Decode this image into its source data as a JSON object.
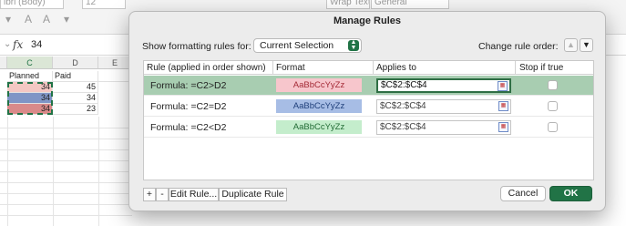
{
  "ribbon": {
    "font_name": "ibri (Body)",
    "font_size": "12",
    "wrap_text": "Wrap Text",
    "number_format": "General"
  },
  "formula_bar": {
    "fx_label": "fx",
    "value": "34"
  },
  "sheet": {
    "columns": [
      "C",
      "D",
      "E"
    ],
    "headers": {
      "c": "Planned",
      "d": "Paid"
    },
    "rows": [
      {
        "c": "34",
        "d": "45",
        "c_fill": "#f4c7c3"
      },
      {
        "c": "34",
        "d": "34",
        "c_fill": "#a4b7dc"
      },
      {
        "c": "34",
        "d": "23",
        "c_fill": "#c6e7c3"
      }
    ]
  },
  "dialog": {
    "title": "Manage Rules",
    "show_label": "Show formatting rules for:",
    "scope": "Current Selection",
    "order_label": "Change rule order:",
    "columns": {
      "rule": "Rule (applied in order shown)",
      "format": "Format",
      "applies": "Applies to",
      "stop": "Stop if true"
    },
    "rules": [
      {
        "rule": "Formula: =C2>D2",
        "preview": "AaBbCcYyZz",
        "bg": "#f7c6cc",
        "fg": "#a42a36",
        "applies": "$C$2:$C$4",
        "stop": false,
        "selected": true
      },
      {
        "rule": "Formula: =C2=D2",
        "preview": "AaBbCcYyZz",
        "bg": "#a7bde5",
        "fg": "#1f3f7a",
        "applies": "$C$2:$C$4",
        "stop": false,
        "selected": false
      },
      {
        "rule": "Formula: =C2<D2",
        "preview": "AaBbCcYyZz",
        "bg": "#c4edcc",
        "fg": "#226b35",
        "applies": "$C$2:$C$4",
        "stop": false,
        "selected": false
      }
    ],
    "buttons": {
      "add": "+",
      "remove": "-",
      "edit": "Edit Rule...",
      "duplicate": "Duplicate Rule",
      "cancel": "Cancel",
      "ok": "OK"
    },
    "accent_color": "#217346"
  }
}
